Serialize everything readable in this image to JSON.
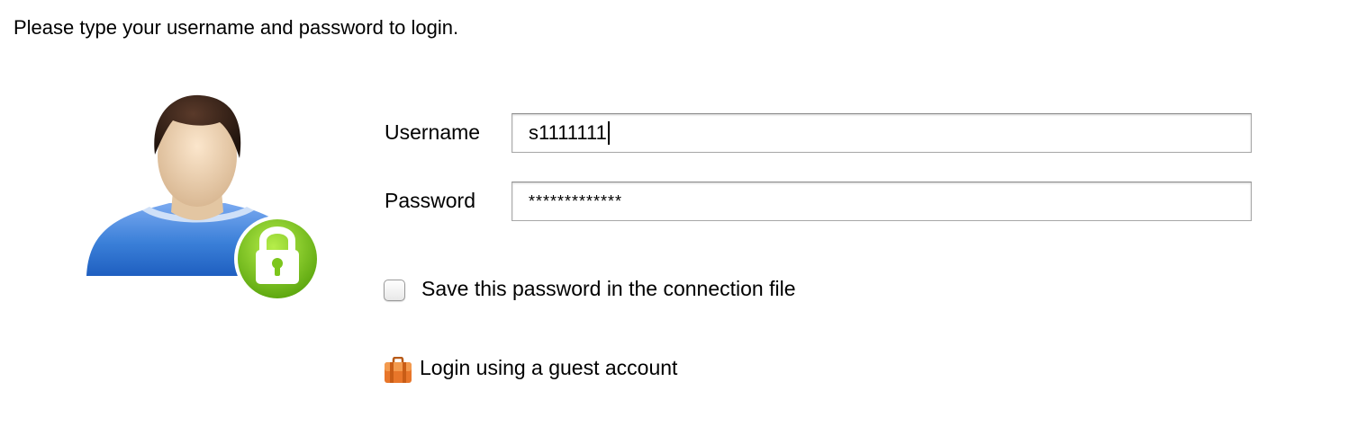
{
  "instruction": "Please type your username and password to login.",
  "icons": {
    "avatar": "user-lock-icon",
    "guest": "briefcase-icon"
  },
  "form": {
    "username_label": "Username",
    "username_value": "s1111111",
    "password_label": "Password",
    "password_value": "*************",
    "save_password_label": "Save this password in the connection file",
    "save_password_checked": false,
    "guest_login_label": "Login using a guest account"
  },
  "colors": {
    "shirt": "#3a7fd8",
    "lock_badge": "#7cc61c",
    "briefcase": "#e8762a"
  }
}
